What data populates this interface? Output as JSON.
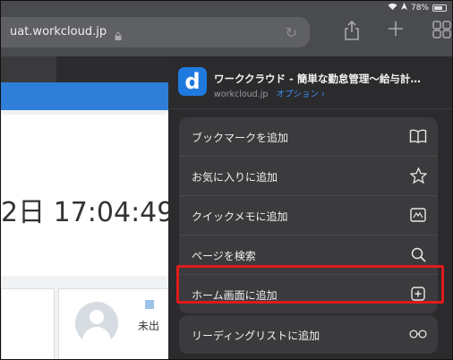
{
  "status_bar": {
    "battery": "78%"
  },
  "browser": {
    "url": "uat.workcloud.jp"
  },
  "page": {
    "time": "2日 17:04:49",
    "status_label": "未出"
  },
  "share_sheet": {
    "app_icon_letter": "d",
    "title": "ワーククラウド - 簡単な勤怠管理〜給与計…",
    "site": "workcloud.jp",
    "options_label": "オプション ›",
    "actions": [
      {
        "label": "ブックマークを追加",
        "icon": "book-icon"
      },
      {
        "label": "お気に入りに追加",
        "icon": "star-icon"
      },
      {
        "label": "クイックメモに追加",
        "icon": "quick-note-icon"
      },
      {
        "label": "ページを検索",
        "icon": "search-icon"
      },
      {
        "label": "ホーム画面に追加",
        "icon": "add-square-icon"
      },
      {
        "label": "リーディングリストに追加",
        "icon": "glasses-icon"
      }
    ]
  },
  "colors": {
    "highlight": "#e01b1b",
    "accent": "#3d8ff5",
    "page_blue": "#2f7fd9"
  }
}
